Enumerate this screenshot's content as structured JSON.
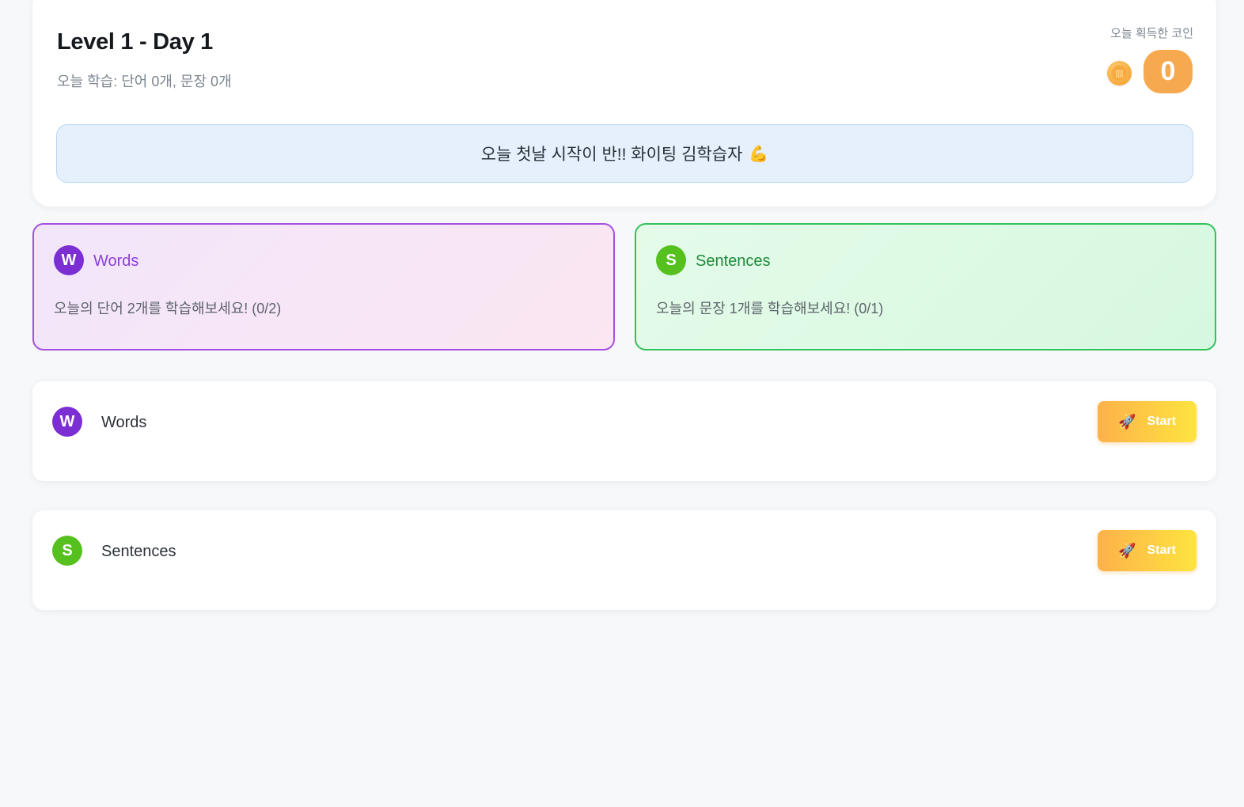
{
  "header": {
    "title": "Level 1 - Day 1",
    "subtitle": "오늘 학습: 단어 0개, 문장 0개",
    "coin_label": "오늘 획득한 코인",
    "coin_count": "0",
    "coin_icon": "coin-icon",
    "motivation": "오늘 첫날 시작이 반!! 화이팅 김학습자",
    "motivation_emoji": "💪"
  },
  "summary": {
    "words": {
      "badge": "W",
      "title": "Words",
      "description": "오늘의 단어 2개를 학습해보세요! (0/2)"
    },
    "sentences": {
      "badge": "S",
      "title": "Sentences",
      "description": "오늘의 문장 1개를 학습해보세요! (0/1)"
    }
  },
  "activities": [
    {
      "badge": "W",
      "title": "Words",
      "button_label": "Start",
      "button_icon": "🚀"
    },
    {
      "badge": "S",
      "title": "Sentences",
      "button_label": "Start",
      "button_icon": "🚀"
    }
  ],
  "colors": {
    "words_accent": "#7b2fd3",
    "sentences_accent": "#56c11e",
    "coin": "#f6a94f",
    "start_gradient": [
      "#fdb14a",
      "#fee43f"
    ]
  }
}
